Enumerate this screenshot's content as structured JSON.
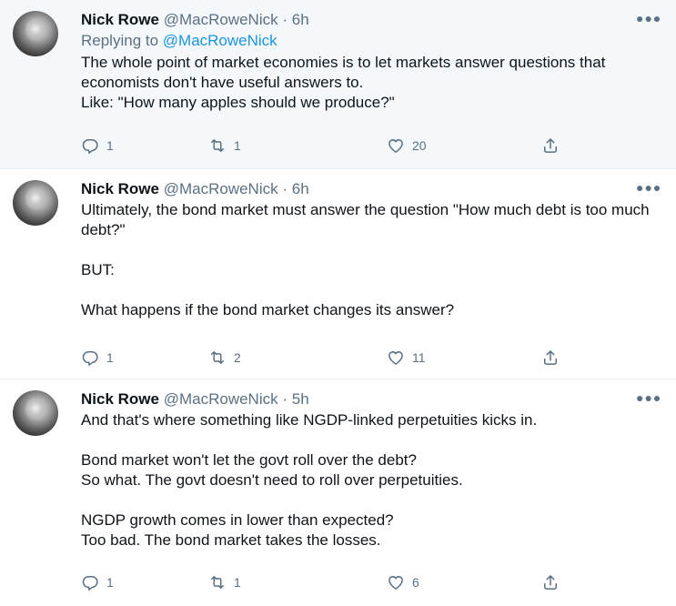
{
  "tweets": [
    {
      "name": "Nick Rowe",
      "handle": "@MacRoweNick",
      "separator": "·",
      "time": "6h",
      "reply_prefix": "Replying to ",
      "reply_to": "@MacRoweNick",
      "paragraphs": [
        "The whole point of market economies is to let markets answer questions that economists don't have useful answers to.\nLike: \"How many apples should we produce?\""
      ],
      "replies": "1",
      "retweets": "1",
      "likes": "20"
    },
    {
      "name": "Nick Rowe",
      "handle": "@MacRoweNick",
      "separator": "·",
      "time": "6h",
      "paragraphs": [
        "Ultimately, the bond market must answer the question \"How much debt is too much debt?\"",
        "BUT:",
        "What happens if the bond market changes its answer?"
      ],
      "replies": "1",
      "retweets": "2",
      "likes": "11"
    },
    {
      "name": "Nick Rowe",
      "handle": "@MacRoweNick",
      "separator": "·",
      "time": "5h",
      "paragraphs": [
        "And that's where something like NGDP-linked perpetuities kicks in.",
        "Bond market won't let the govt roll over the debt?\nSo what. The govt doesn't need to roll over perpetuities.",
        "NGDP growth comes in lower than expected?\nToo bad. The bond market takes the losses."
      ],
      "replies": "1",
      "retweets": "1",
      "likes": "6"
    }
  ],
  "icons": {
    "more": "more-options-icon",
    "reply": "reply-icon",
    "retweet": "retweet-icon",
    "like": "heart-icon",
    "share": "share-icon"
  },
  "colors": {
    "link": "#1b95e0",
    "secondary_text": "#5b7083",
    "highlight_bg": "#f5f8fa",
    "divider": "#e6ecf0"
  }
}
